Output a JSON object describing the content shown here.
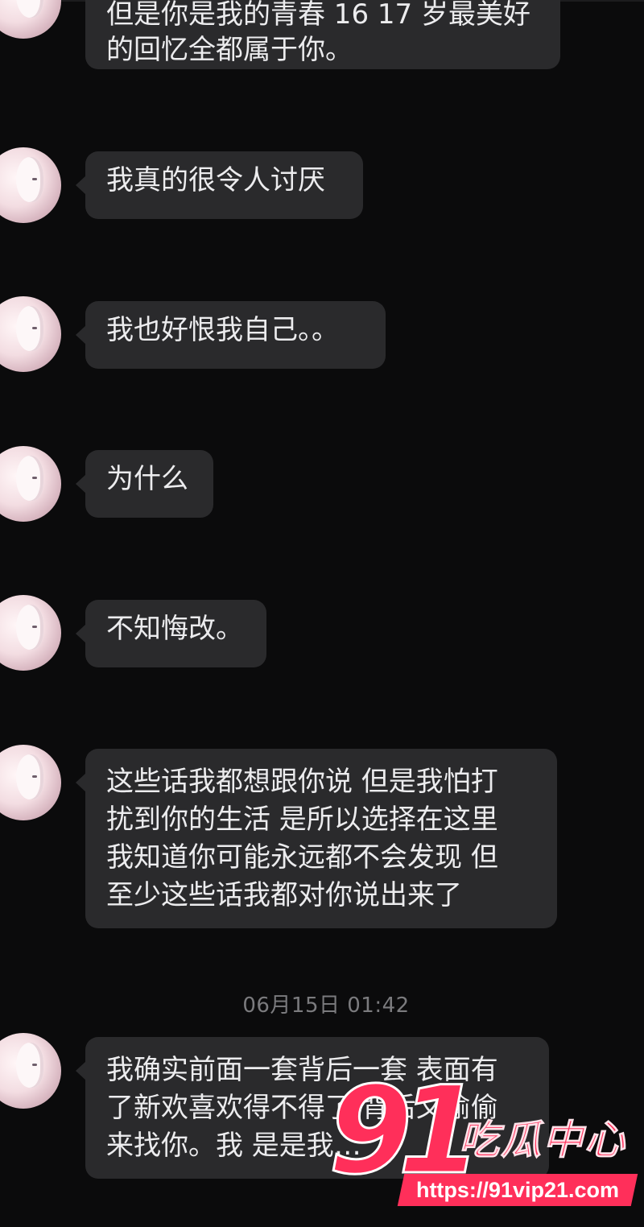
{
  "chat": {
    "messages": [
      {
        "lines": [
          "但是你是我的青春 16 17 岁最美好",
          "的回忆全都属于你。"
        ]
      },
      {
        "lines": [
          "我真的很令人讨厌"
        ]
      },
      {
        "lines": [
          "我也好恨我自己。。"
        ]
      },
      {
        "lines": [
          "为什么"
        ]
      },
      {
        "lines": [
          "不知悔改。"
        ]
      },
      {
        "lines": [
          "这些话我都想跟你说 但是我怕打",
          "扰到你的生活 是所以选择在这里",
          "我知道你可能永远都不会发现 但",
          "至少这些话我都对你说出来了"
        ]
      },
      {
        "lines": [
          "我确实前面一套背后一套 表面有",
          "了新欢喜欢得不得了 背后又偷偷",
          "来找你。我 是是我…"
        ]
      }
    ],
    "timestamp": "06月15日 01:42"
  },
  "watermark": {
    "number": "91",
    "brand": "吃瓜中心",
    "url": "https://91vip21.com"
  },
  "colors": {
    "background": "#0b0b0c",
    "bubble": "#2a2a2c",
    "text": "#ececee",
    "timestamp": "#7b7b7e",
    "watermark": "#ff2f5a"
  },
  "icons": {
    "avatar": "anime-girl-avatar"
  }
}
